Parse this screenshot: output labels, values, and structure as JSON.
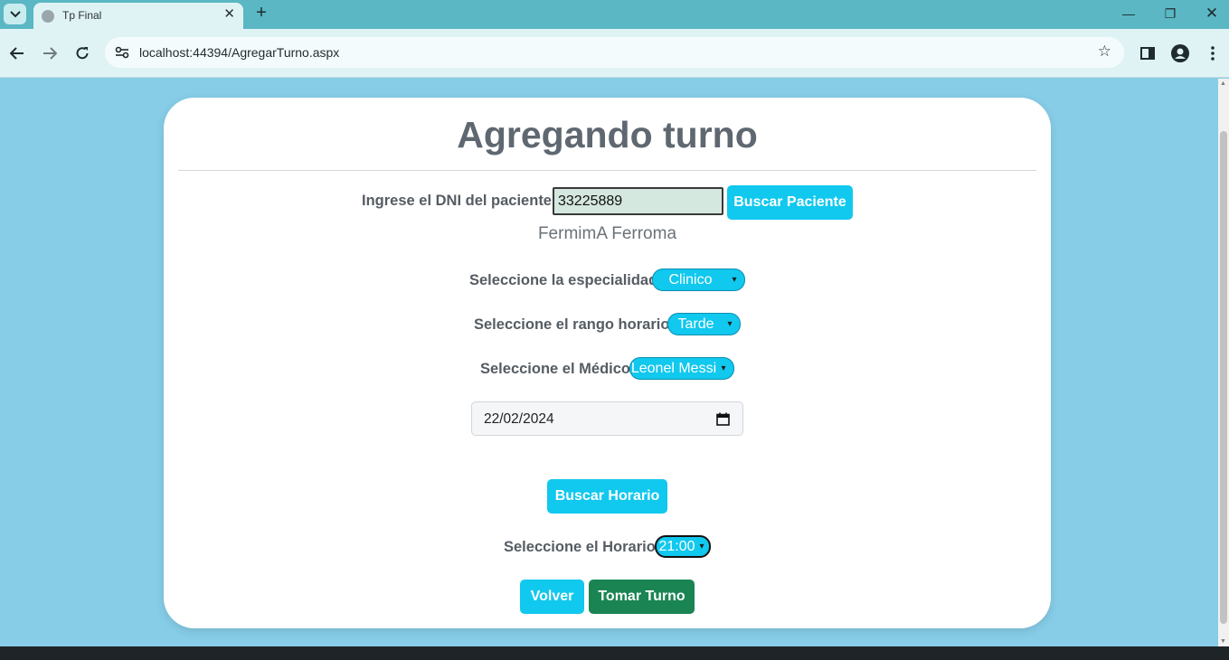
{
  "browser": {
    "tab_title": "Tp Final",
    "url_host": "localhost",
    "url_rest": ":44394/AgregarTurno.aspx"
  },
  "form": {
    "title": "Agregando turno",
    "dni_label": "Ingrese el DNI del paciente:",
    "dni_value": "33225889",
    "search_patient_label": "Buscar Paciente",
    "patient_name": "FermimA Ferroma",
    "specialty_label": "Seleccione la especialidad:",
    "specialty_value": "Clinico",
    "range_label": "Seleccione el rango horario:",
    "range_value": "Tarde",
    "doctor_label": "Seleccione el Médico:",
    "doctor_value": "Leonel Messi",
    "date_value": "22/02/2024",
    "search_schedule_label": "Buscar Horario",
    "time_label": "Seleccione el Horario:",
    "time_value": "21:00",
    "back_label": "Volver",
    "submit_label": "Tomar Turno"
  },
  "colors": {
    "page_background": "#87cde8",
    "accent_cyan": "#11c8ee",
    "accent_green": "#1a8553",
    "tabstrip": "#5ab7c3"
  }
}
